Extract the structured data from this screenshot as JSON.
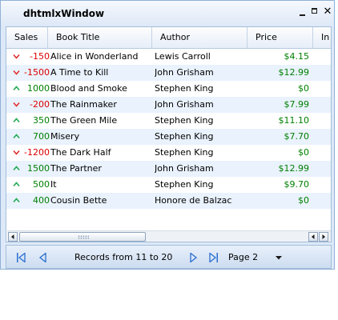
{
  "window": {
    "title": "dhtmlxWindow"
  },
  "grid": {
    "columns": [
      "Sales",
      "Book Title",
      "Author",
      "Price",
      "In"
    ],
    "rows": [
      {
        "trend": "down",
        "sales": "-150",
        "title": "Alice in Wonderland",
        "author": "Lewis Carroll",
        "price": "$4.15"
      },
      {
        "trend": "down",
        "sales": "-1500",
        "title": "A Time to Kill",
        "author": "John Grisham",
        "price": "$12.99"
      },
      {
        "trend": "up",
        "sales": "1000",
        "title": "Blood and Smoke",
        "author": "Stephen King",
        "price": "$0"
      },
      {
        "trend": "down",
        "sales": "-200",
        "title": "The Rainmaker",
        "author": "John Grisham",
        "price": "$7.99"
      },
      {
        "trend": "up",
        "sales": "350",
        "title": "The Green Mile",
        "author": "Stephen King",
        "price": "$11.10"
      },
      {
        "trend": "up",
        "sales": "700",
        "title": "Misery",
        "author": "Stephen King",
        "price": "$7.70"
      },
      {
        "trend": "down",
        "sales": "-1200",
        "title": "The Dark Half",
        "author": "Stephen King",
        "price": "$0"
      },
      {
        "trend": "up",
        "sales": "1500",
        "title": "The Partner",
        "author": "John Grisham",
        "price": "$12.99"
      },
      {
        "trend": "up",
        "sales": "500",
        "title": "It",
        "author": "Stephen King",
        "price": "$9.70"
      },
      {
        "trend": "up",
        "sales": "400",
        "title": "Cousin Bette",
        "author": "Honore de Balzac",
        "price": "$0"
      }
    ]
  },
  "pager": {
    "records_text": "Records from 11 to 20",
    "page_select": "Page 2"
  },
  "colors": {
    "negative": "#dd0000",
    "positive": "#008000",
    "up_arrow": "#22aa55",
    "down_arrow": "#e03030",
    "pager_icon": "#2a6fcf"
  }
}
